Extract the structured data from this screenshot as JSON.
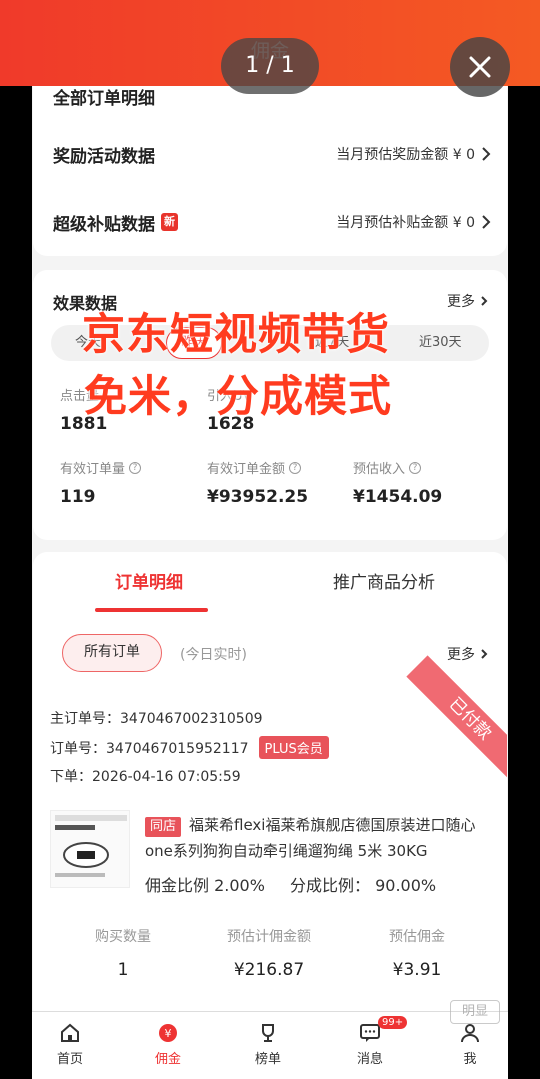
{
  "header": {
    "title": "佣金",
    "page_indicator": "1 / 1",
    "partial_row_label": "全部订单明细"
  },
  "rows": [
    {
      "label": "奖励活动数据",
      "right": "当月预估奖励金额 ¥ 0",
      "tag": ""
    },
    {
      "label": "超级补贴数据",
      "right": "当月预估补贴金额 ¥ 0",
      "tag": "新"
    }
  ],
  "effect": {
    "title": "效果数据",
    "more": "更多",
    "tabs": [
      "今天",
      "昨天",
      "近7天",
      "近30天"
    ],
    "metrics": [
      {
        "label": "点击量",
        "value": "1881"
      },
      {
        "label": "引入UV",
        "value": "1628"
      },
      {
        "label": "有效订单量",
        "value": "119"
      },
      {
        "label": "有效订单金额",
        "value": "¥93952.25"
      },
      {
        "label": "预估收入",
        "value": "¥1454.09"
      }
    ]
  },
  "overlay": {
    "line1": "京东短视频带货",
    "line2": "免米，分成模式"
  },
  "orders": {
    "tab_active": "订单明细",
    "tab_other": "推广商品分析",
    "filter": "所有订单",
    "filter_note": "(今日实时)",
    "more": "更多",
    "status": "已付款",
    "main_order_label": "主订单号：",
    "main_order_no": "3470467002310509",
    "order_label": "订单号：",
    "order_no": "3470467015952117",
    "plus_badge": "PLUS会员",
    "time_label": "下单：",
    "order_time": "2026-04-16 07:05:59",
    "store_tag": "同店",
    "product_title": "福莱希flexi福莱希旗舰店德国原装进口随心one系列狗狗自动牵引绳遛狗绳 5米 30KG",
    "commission_rate": "佣金比例 2.00%",
    "share_rate": "分成比例：  90.00%",
    "stats": [
      {
        "label": "购买数量",
        "value": "1"
      },
      {
        "label": "预估计佣金额",
        "value": "¥216.87"
      },
      {
        "label": "预估佣金",
        "value": "¥3.91"
      }
    ]
  },
  "nav": [
    {
      "label": "首页",
      "icon": "home-icon"
    },
    {
      "label": "佣金",
      "icon": "yen-icon"
    },
    {
      "label": "榜单",
      "icon": "trophy-icon"
    },
    {
      "label": "消息",
      "icon": "message-icon",
      "badge": "99+"
    },
    {
      "label": "我",
      "icon": "profile-icon"
    }
  ],
  "watermark": "明显",
  "colors": {
    "accent": "#e33",
    "header_gradient_start": "#f03a2a",
    "header_gradient_end": "#f45a23"
  }
}
